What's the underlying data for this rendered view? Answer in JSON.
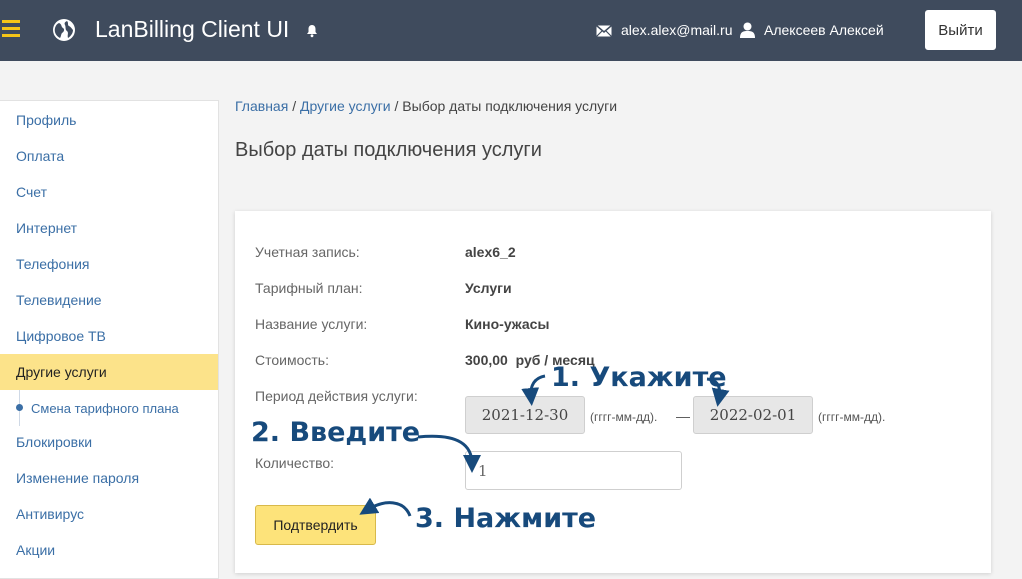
{
  "header": {
    "app_title": "LanBilling Client UI",
    "email": "alex.alex@mail.ru",
    "username": "Алексеев Алексей",
    "logout_label": "Выйти"
  },
  "sidebar": {
    "items": [
      {
        "label": "Профиль"
      },
      {
        "label": "Оплата"
      },
      {
        "label": "Счет"
      },
      {
        "label": "Интернет"
      },
      {
        "label": "Телефония"
      },
      {
        "label": "Телевидение"
      },
      {
        "label": "Цифровое ТВ"
      },
      {
        "label": "Другие услуги",
        "active": true
      },
      {
        "label": "Смена тарифного плана",
        "sub": true
      },
      {
        "label": "Блокировки"
      },
      {
        "label": "Изменение пароля"
      },
      {
        "label": "Антивирус"
      },
      {
        "label": "Акции"
      }
    ]
  },
  "breadcrumb": {
    "home": "Главная",
    "sep1": "/",
    "section": "Другие услуги",
    "sep2": "/",
    "current": "Выбор даты подключения услуги"
  },
  "page_title": "Выбор даты подключения услуги",
  "form": {
    "account_label": "Учетная запись:",
    "account_value": "alex6_2",
    "plan_label": "Тарифный план:",
    "plan_value": "Услуги",
    "service_label": "Название услуги:",
    "service_value": "Кино-ужасы",
    "cost_label": "Стоимость:",
    "cost_value": "300,00  руб / месяц",
    "period_label": "Период действия услуги:",
    "date_from": "2021-12-30",
    "date_to": "2022-02-01",
    "date_hint": "(гггг-мм-дд).",
    "dash": "—",
    "quantity_label": "Количество:",
    "quantity_value": "1",
    "confirm_label": "Подтвердить"
  },
  "annotations": {
    "step1": "1. Укажите",
    "step2": "2. Введите",
    "step3": "3. Нажмите"
  },
  "colors": {
    "topbar": "#3f4b5d",
    "accent_yellow": "#fce38a",
    "link": "#3b6fa6",
    "annotation": "#174a7c"
  }
}
